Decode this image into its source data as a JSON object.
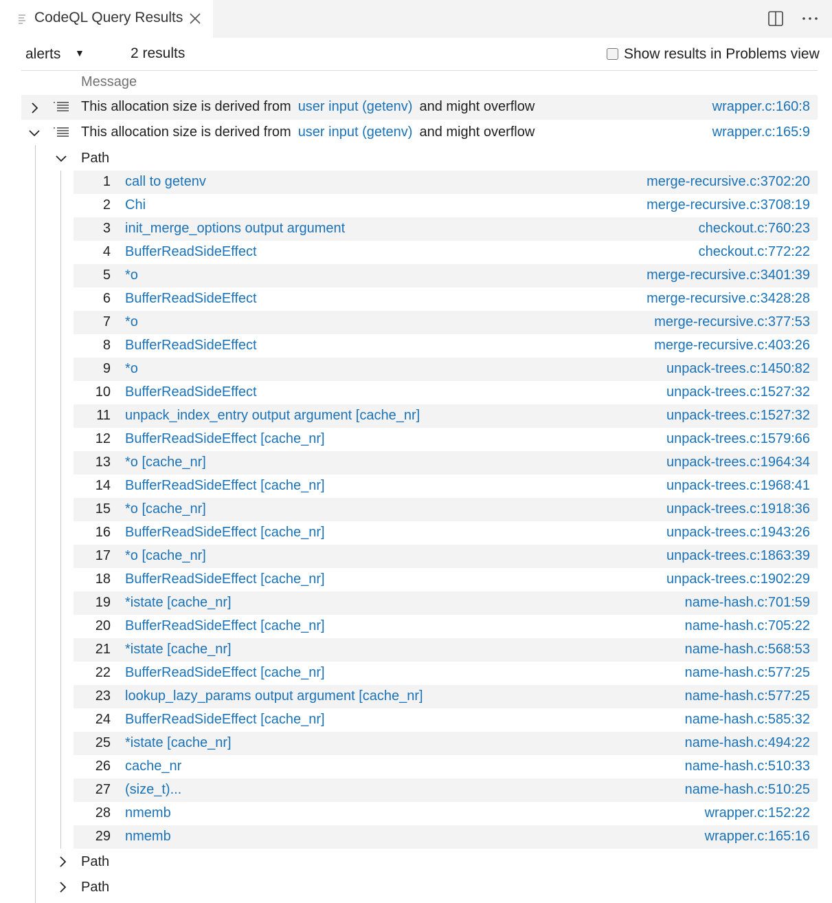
{
  "tab": {
    "title": "CodeQL Query Results"
  },
  "toolbar": {
    "result_set": "alerts",
    "result_count": "2 results",
    "problems_checkbox_label": "Show results in Problems view",
    "problems_checkbox_checked": false
  },
  "table": {
    "column_message": "Message"
  },
  "alerts": [
    {
      "expanded": false,
      "message_prefix": "This allocation size is derived from",
      "message_link": "user input (getenv)",
      "message_suffix": "and might overflow",
      "location": "wrapper.c:160:8"
    },
    {
      "expanded": true,
      "message_prefix": "This allocation size is derived from",
      "message_link": "user input (getenv)",
      "message_suffix": "and might overflow",
      "location": "wrapper.c:165:9"
    }
  ],
  "paths": [
    {
      "label": "Path",
      "expanded": true,
      "steps": [
        {
          "num": "1",
          "text": "call to getenv",
          "loc": "merge-recursive.c:3702:20"
        },
        {
          "num": "2",
          "text": "Chi",
          "loc": "merge-recursive.c:3708:19"
        },
        {
          "num": "3",
          "text": "init_merge_options output argument",
          "loc": "checkout.c:760:23"
        },
        {
          "num": "4",
          "text": "BufferReadSideEffect",
          "loc": "checkout.c:772:22"
        },
        {
          "num": "5",
          "text": "*o",
          "loc": "merge-recursive.c:3401:39"
        },
        {
          "num": "6",
          "text": "BufferReadSideEffect",
          "loc": "merge-recursive.c:3428:28"
        },
        {
          "num": "7",
          "text": "*o",
          "loc": "merge-recursive.c:377:53"
        },
        {
          "num": "8",
          "text": "BufferReadSideEffect",
          "loc": "merge-recursive.c:403:26"
        },
        {
          "num": "9",
          "text": "*o",
          "loc": "unpack-trees.c:1450:82"
        },
        {
          "num": "10",
          "text": "BufferReadSideEffect",
          "loc": "unpack-trees.c:1527:32"
        },
        {
          "num": "11",
          "text": "unpack_index_entry output argument [cache_nr]",
          "loc": "unpack-trees.c:1527:32"
        },
        {
          "num": "12",
          "text": "BufferReadSideEffect [cache_nr]",
          "loc": "unpack-trees.c:1579:66"
        },
        {
          "num": "13",
          "text": "*o [cache_nr]",
          "loc": "unpack-trees.c:1964:34"
        },
        {
          "num": "14",
          "text": "BufferReadSideEffect [cache_nr]",
          "loc": "unpack-trees.c:1968:41"
        },
        {
          "num": "15",
          "text": "*o [cache_nr]",
          "loc": "unpack-trees.c:1918:36"
        },
        {
          "num": "16",
          "text": "BufferReadSideEffect [cache_nr]",
          "loc": "unpack-trees.c:1943:26"
        },
        {
          "num": "17",
          "text": "*o [cache_nr]",
          "loc": "unpack-trees.c:1863:39"
        },
        {
          "num": "18",
          "text": "BufferReadSideEffect [cache_nr]",
          "loc": "unpack-trees.c:1902:29"
        },
        {
          "num": "19",
          "text": "*istate [cache_nr]",
          "loc": "name-hash.c:701:59"
        },
        {
          "num": "20",
          "text": "BufferReadSideEffect [cache_nr]",
          "loc": "name-hash.c:705:22"
        },
        {
          "num": "21",
          "text": "*istate [cache_nr]",
          "loc": "name-hash.c:568:53"
        },
        {
          "num": "22",
          "text": "BufferReadSideEffect [cache_nr]",
          "loc": "name-hash.c:577:25"
        },
        {
          "num": "23",
          "text": "lookup_lazy_params output argument [cache_nr]",
          "loc": "name-hash.c:577:25"
        },
        {
          "num": "24",
          "text": "BufferReadSideEffect [cache_nr]",
          "loc": "name-hash.c:585:32"
        },
        {
          "num": "25",
          "text": "*istate [cache_nr]",
          "loc": "name-hash.c:494:22"
        },
        {
          "num": "26",
          "text": "cache_nr",
          "loc": "name-hash.c:510:33"
        },
        {
          "num": "27",
          "text": "(size_t)...",
          "loc": "name-hash.c:510:25"
        },
        {
          "num": "28",
          "text": "nmemb",
          "loc": "wrapper.c:152:22"
        },
        {
          "num": "29",
          "text": "nmemb",
          "loc": "wrapper.c:165:16"
        }
      ]
    },
    {
      "label": "Path",
      "expanded": false,
      "steps": []
    },
    {
      "label": "Path",
      "expanded": false,
      "steps": []
    }
  ]
}
